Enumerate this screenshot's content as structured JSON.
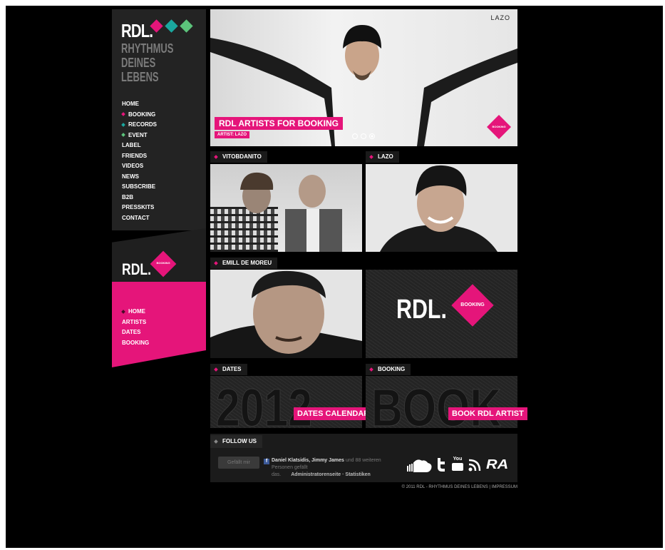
{
  "brand": {
    "logo": "RDL.",
    "tagline": [
      "RHYTHMUS",
      "DEINES",
      "LEBENS"
    ],
    "colors": {
      "pink": "#e5157a",
      "teal": "#1aa79e",
      "green": "#5cc37b",
      "dark": "#232323"
    }
  },
  "main_nav": [
    {
      "label": "HOME",
      "dot": ""
    },
    {
      "label": "BOOKING",
      "dot": "#e5157a"
    },
    {
      "label": "RECORDS",
      "dot": "#1aa79e"
    },
    {
      "label": "EVENT",
      "dot": "#5cc37b"
    },
    {
      "label": "LABEL",
      "dot": ""
    },
    {
      "label": "FRIENDS",
      "dot": ""
    },
    {
      "label": "VIDEOS",
      "dot": ""
    },
    {
      "label": "NEWS",
      "dot": ""
    },
    {
      "label": "SUBSCRIBE",
      "dot": ""
    },
    {
      "label": "B2B",
      "dot": ""
    },
    {
      "label": "PRESSKITS",
      "dot": ""
    },
    {
      "label": "CONTACT",
      "dot": ""
    }
  ],
  "booking_logo": {
    "text": "RDL.",
    "badge": "BOOKING"
  },
  "booking_nav": [
    {
      "label": "HOME"
    },
    {
      "label": "ARTISTS"
    },
    {
      "label": "DATES"
    },
    {
      "label": "BOOKING"
    }
  ],
  "hero": {
    "corner_label": "LAZO",
    "title": "RDL ARTISTS FOR BOOKING",
    "subtitle": "ARTIST: LAZO",
    "badge": "BOOKING",
    "slides": 3,
    "active_slide": 3
  },
  "tiles": {
    "vitobdanito": "VITOBDANITO",
    "lazo": "LAZO",
    "emill": "EMILL DE MOREU",
    "booking_tile_logo": "RDL.",
    "booking_tile_badge": "BOOKING",
    "dates_label": "DATES",
    "dates_bg": "2012",
    "dates_button": "DATES CALENDAR",
    "booking_label": "BOOKING",
    "booking_bg": "BOOK",
    "booking_button": "BOOK RDL ARTIST"
  },
  "follow": {
    "label": "FOLLOW US",
    "like_button": "Gefällt mir",
    "names": "Daniel Klatsidis, Jimmy James",
    "more": "und 88 weiteren",
    "line2": "Personen gefällt",
    "line3": "das.",
    "link": "Administratorenseite · Statistiken",
    "icons": [
      "soundcloud-icon",
      "twitter-icon",
      "youtube-icon",
      "rss-icon",
      "ra-icon"
    ],
    "youtube_text": "You",
    "ra_text": "RA"
  },
  "footer": "© 2011 RDL - RHYTHMUS DEINES LEBENS | IMPRESSUM"
}
